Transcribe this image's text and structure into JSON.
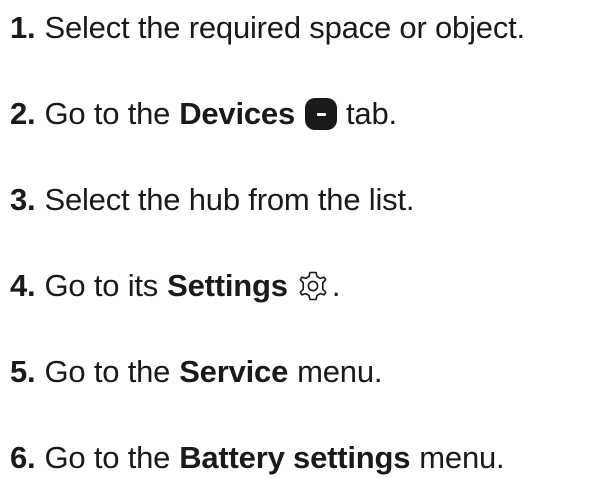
{
  "steps": [
    {
      "num": "1.",
      "pre": "Select the required space or object."
    },
    {
      "num": "2.",
      "pre": "Go to the",
      "bold": "Devices",
      "post": "tab.",
      "icon": "devices-tab-icon"
    },
    {
      "num": "3.",
      "pre": "Select the hub from the list."
    },
    {
      "num": "4.",
      "pre": "Go to its",
      "bold": "Settings",
      "post": ".",
      "icon": "gear-icon"
    },
    {
      "num": "5.",
      "pre": "Go to the",
      "bold": "Service",
      "post": "menu."
    },
    {
      "num": "6.",
      "pre": "Go to the",
      "bold": "Battery settings",
      "post": "menu."
    }
  ],
  "colors": {
    "text": "#1a1a1a",
    "background": "#ffffff"
  }
}
